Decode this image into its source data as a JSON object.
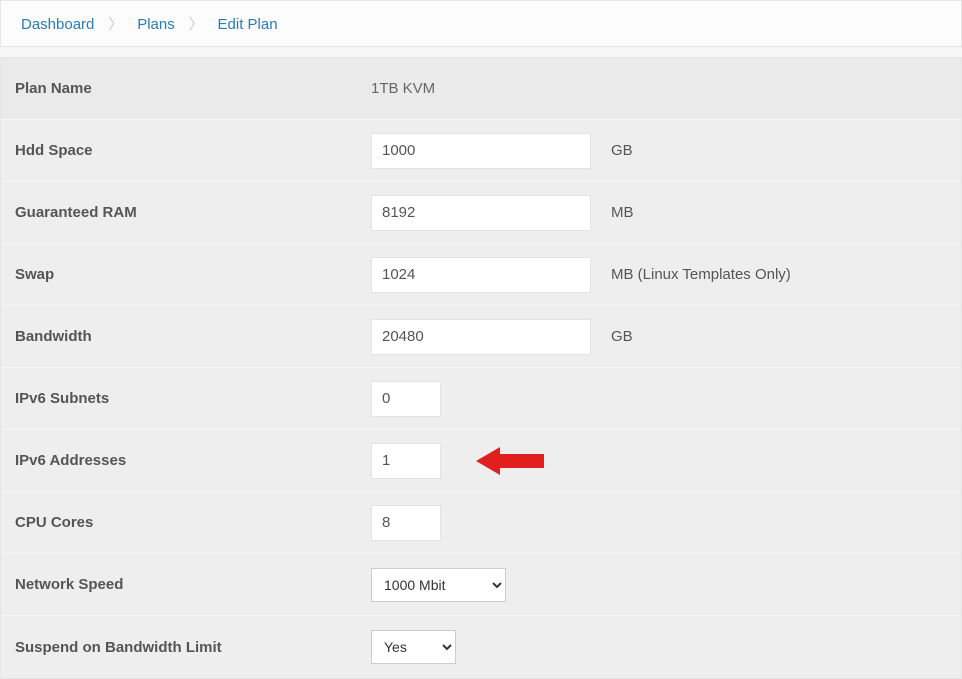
{
  "breadcrumb": {
    "dashboard": "Dashboard",
    "plans": "Plans",
    "edit_plan": "Edit Plan"
  },
  "form": {
    "plan_name_label": "Plan Name",
    "plan_name_value": "1TB KVM",
    "hdd_space_label": "Hdd Space",
    "hdd_space_value": "1000",
    "hdd_space_unit": "GB",
    "ram_label": "Guaranteed RAM",
    "ram_value": "8192",
    "ram_unit": "MB",
    "swap_label": "Swap",
    "swap_value": "1024",
    "swap_unit": "MB (Linux Templates Only)",
    "bandwidth_label": "Bandwidth",
    "bandwidth_value": "20480",
    "bandwidth_unit": "GB",
    "ipv6_subnets_label": "IPv6 Subnets",
    "ipv6_subnets_value": "0",
    "ipv6_addresses_label": "IPv6 Addresses",
    "ipv6_addresses_value": "1",
    "cpu_cores_label": "CPU Cores",
    "cpu_cores_value": "8",
    "network_speed_label": "Network Speed",
    "network_speed_value": "1000 Mbit",
    "suspend_label": "Suspend on Bandwidth Limit",
    "suspend_value": "Yes"
  },
  "annotation": {
    "arrow_color": "#e11f1f"
  }
}
